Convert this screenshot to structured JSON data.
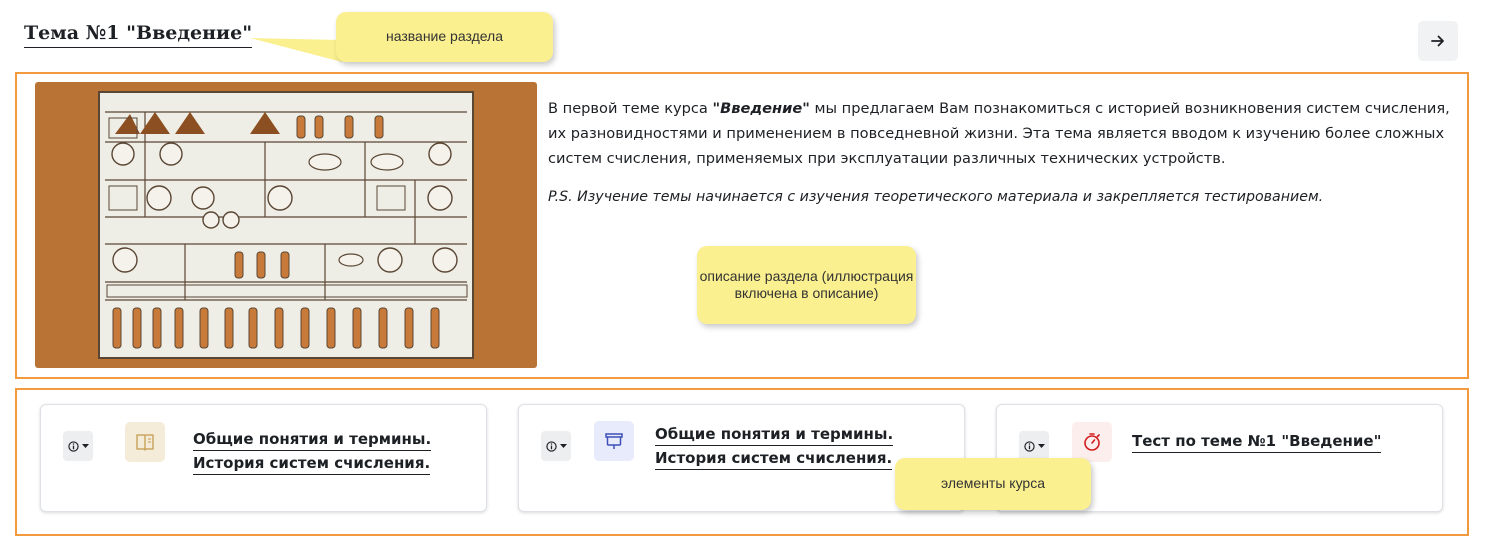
{
  "section": {
    "title": "Тема №1 \"Введение\"",
    "description_lead": "В первой теме курса ",
    "description_bold": "\"Введение\"",
    "description_rest": " мы предлагаем Вам познакомиться с историей возникновения систем счисления, их разновидностями и применением в повседневной жизни. Эта тема является вводом к изучению более сложных систем счисления, применяемых при эксплуатации различных технических устройств.",
    "ps": "P.S. Изучение темы начинается с изучения теоретического материала и закрепляется тестированием."
  },
  "notes": {
    "title_note": "название раздела",
    "description_note": "описание раздела (иллюстрация включена в описание)",
    "elements_note": "элементы курса"
  },
  "activities": [
    {
      "title_line1": "Общие понятия и термины.",
      "title_line2": "История систем счисления.",
      "icon": "book-icon",
      "icon_bg": "#f4ecd8",
      "icon_color": "#c9a663"
    },
    {
      "title_line1": "Общие понятия и термины.",
      "title_line2": "История систем счисления.",
      "icon": "presentation-icon",
      "icon_bg": "#e8ebfb",
      "icon_color": "#3e4fb8"
    },
    {
      "title_line1": "Тест по теме №1 \"Введение\"",
      "title_line2": "",
      "icon": "stopwatch-icon",
      "icon_bg": "#fdeeee",
      "icon_color": "#d11d1d"
    }
  ],
  "icons": {
    "nav_button": "arrow-right-icon",
    "info_button": "info-circle-icon"
  }
}
